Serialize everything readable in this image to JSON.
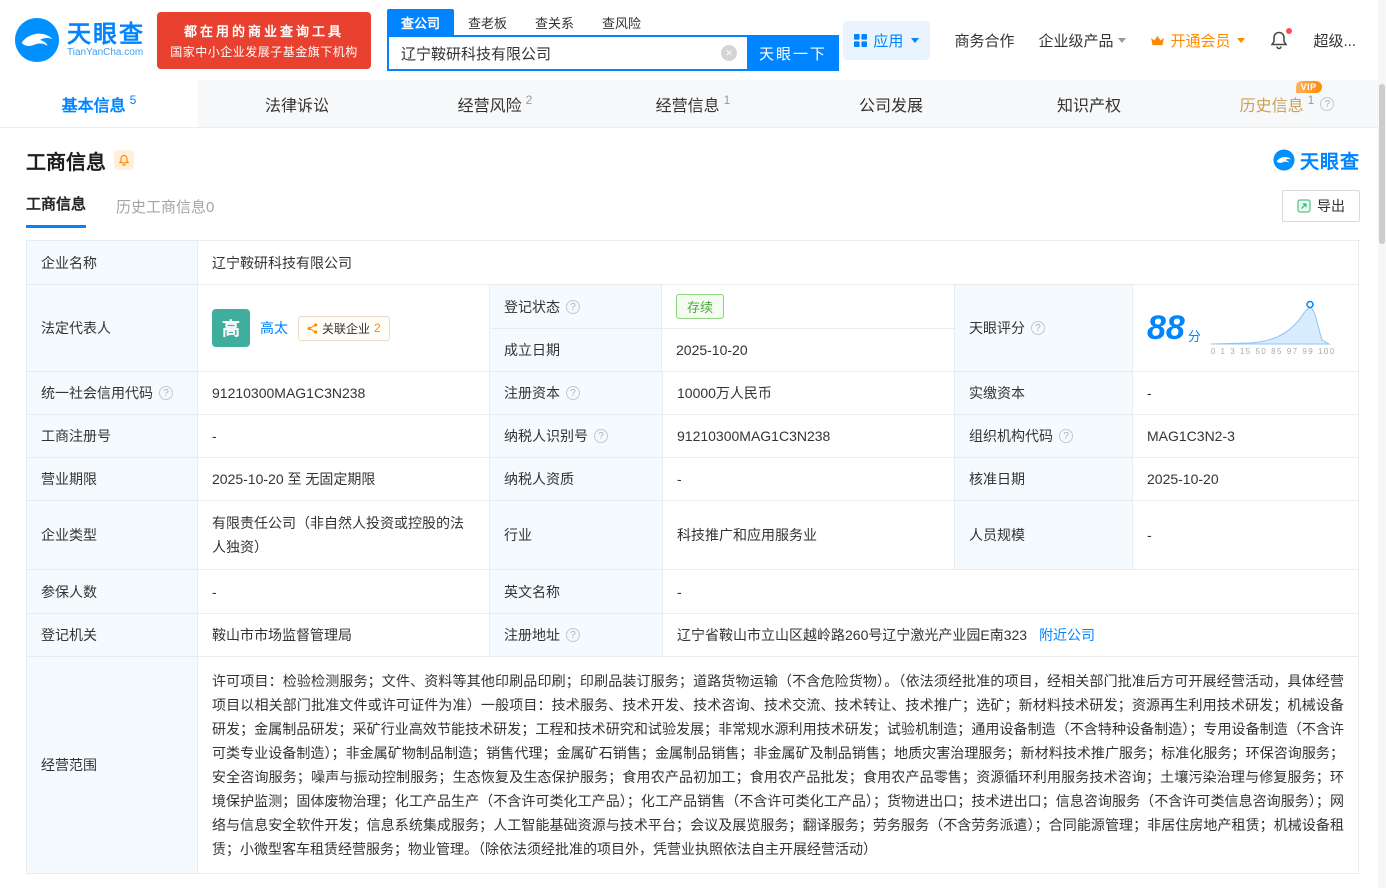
{
  "colors": {
    "accent": "#0084ff",
    "banner_red": "#e8412f",
    "orange": "#ff8a00",
    "status_green": "#49ad3a",
    "gold": "#c9a158"
  },
  "icons": {
    "logo": "tianyancha-logo-icon",
    "clear": "clear-icon",
    "apps": "grid-icon",
    "caret": "chevron-down-icon",
    "crown": "crown-icon",
    "bell": "bell-icon",
    "help": "question-circle-icon",
    "export": "export-icon",
    "related": "share-icon",
    "score_chart": "score-curve-chart"
  },
  "header": {
    "logo": {
      "name": "天眼查",
      "domain": "TianYanCha.com"
    },
    "banner": {
      "line1": "都在用的商业查询工具",
      "line2": "国家中小企业发展子基金旗下机构"
    },
    "search": {
      "tabs": [
        "查公司",
        "查老板",
        "查关系",
        "查风险"
      ],
      "value": "辽宁鞍研科技有限公司",
      "button": "天眼一下"
    },
    "menu": {
      "apps": "应用",
      "cooperation": "商务合作",
      "enterprise": "企业级产品",
      "vip": "开通会员",
      "super": "超级..."
    }
  },
  "nav_tabs": [
    {
      "label": "基本信息",
      "count": "5"
    },
    {
      "label": "法律诉讼",
      "count": ""
    },
    {
      "label": "经营风险",
      "count": "2"
    },
    {
      "label": "经营信息",
      "count": "1"
    },
    {
      "label": "公司发展",
      "count": ""
    },
    {
      "label": "知识产权",
      "count": ""
    },
    {
      "label": "历史信息",
      "count": "1",
      "badge": "VIP"
    }
  ],
  "section": {
    "title": "工商信息",
    "brand": "天眼查",
    "subtabs": [
      "工商信息",
      "历史工商信息0"
    ],
    "export": "导出"
  },
  "info": {
    "company_name": {
      "label": "企业名称",
      "value": "辽宁鞍研科技有限公司"
    },
    "legal_rep": {
      "label": "法定代表人",
      "avatar": "高",
      "name": "高太",
      "related_label": "关联企业",
      "related_count": "2"
    },
    "reg_status": {
      "label": "登记状态",
      "value": "存续"
    },
    "establish_date": {
      "label": "成立日期",
      "value": "2025-10-20"
    },
    "score": {
      "label": "天眼评分",
      "value": "88",
      "unit": "分",
      "axis": "0 1 3 15 50 85 97 99 100"
    },
    "credit_code": {
      "label": "统一社会信用代码",
      "value": "91210300MAG1C3N238"
    },
    "reg_capital": {
      "label": "注册资本",
      "value": "10000万人民币"
    },
    "paid_capital": {
      "label": "实缴资本",
      "value": "-"
    },
    "reg_number": {
      "label": "工商注册号",
      "value": "-"
    },
    "taxpayer_id": {
      "label": "纳税人识别号",
      "value": "91210300MAG1C3N238"
    },
    "org_code": {
      "label": "组织机构代码",
      "value": "MAG1C3N2-3"
    },
    "business_term": {
      "label": "营业期限",
      "value": "2025-10-20 至 无固定期限"
    },
    "taxpayer_quality": {
      "label": "纳税人资质",
      "value": "-"
    },
    "approval_date": {
      "label": "核准日期",
      "value": "2025-10-20"
    },
    "company_type": {
      "label": "企业类型",
      "value": "有限责任公司（非自然人投资或控股的法人独资）"
    },
    "industry": {
      "label": "行业",
      "value": "科技推广和应用服务业"
    },
    "staff_size": {
      "label": "人员规模",
      "value": "-"
    },
    "insured_count": {
      "label": "参保人数",
      "value": "-"
    },
    "english_name": {
      "label": "英文名称",
      "value": "-"
    },
    "reg_authority": {
      "label": "登记机关",
      "value": "鞍山市市场监督管理局"
    },
    "reg_address": {
      "label": "注册地址",
      "value": "辽宁省鞍山市立山区越岭路260号辽宁激光产业园E南323",
      "link": "附近公司"
    },
    "business_scope": {
      "label": "经营范围",
      "value": "许可项目：检验检测服务；文件、资料等其他印刷品印刷；印刷品装订服务；道路货物运输（不含危险货物）。（依法须经批准的项目，经相关部门批准后方可开展经营活动，具体经营项目以相关部门批准文件或许可证件为准）一般项目：技术服务、技术开发、技术咨询、技术交流、技术转让、技术推广；选矿；新材料技术研发；资源再生利用技术研发；机械设备研发；金属制品研发；采矿行业高效节能技术研发；工程和技术研究和试验发展；非常规水源利用技术研发；试验机制造；通用设备制造（不含特种设备制造）；专用设备制造（不含许可类专业设备制造）；非金属矿物制品制造；销售代理；金属矿石销售；金属制品销售；非金属矿及制品销售；地质灾害治理服务；新材料技术推广服务；标准化服务；环保咨询服务；安全咨询服务；噪声与振动控制服务；生态恢复及生态保护服务；食用农产品初加工；食用农产品批发；食用农产品零售；资源循环利用服务技术咨询；土壤污染治理与修复服务；环境保护监测；固体废物治理；化工产品生产（不含许可类化工产品）；化工产品销售（不含许可类化工产品）；货物进出口；技术进出口；信息咨询服务（不含许可类信息咨询服务）；网络与信息安全软件开发；信息系统集成服务；人工智能基础资源与技术平台；会议及展览服务；翻译服务；劳务服务（不含劳务派遣）；合同能源管理；非居住房地产租赁；机械设备租赁；小微型客车租赁经营服务；物业管理。（除依法须经批准的项目外，凭营业执照依法自主开展经营活动）"
    }
  }
}
